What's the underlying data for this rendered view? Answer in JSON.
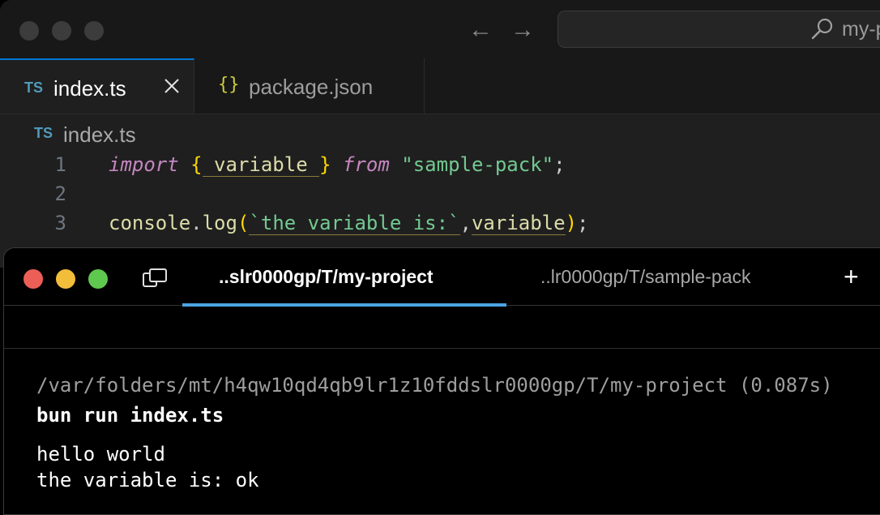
{
  "editor": {
    "search_text": "my-p",
    "tabs": [
      {
        "badge": "TS",
        "label": "index.ts"
      },
      {
        "badge": "{}",
        "label": "package.json"
      }
    ],
    "breadcrumb": {
      "badge": "TS",
      "label": "index.ts"
    },
    "code": [
      {
        "num": "1",
        "tokens": [
          "import",
          " ",
          "{",
          " variable ",
          "}",
          " ",
          "from",
          " ",
          "\"sample-pack\"",
          ";"
        ]
      },
      {
        "num": "2"
      },
      {
        "num": "3",
        "tokens": [
          "console",
          ".",
          "log",
          "(",
          "`the variable is:`",
          ",",
          "variable",
          ")",
          ";"
        ]
      }
    ]
  },
  "terminal": {
    "tabs": [
      "..slr0000gp/T/my-project",
      "..lr0000gp/T/sample-pack"
    ],
    "new_tab": "+",
    "output": {
      "path_line": "/var/folders/mt/h4qw10qd4qb9lr1z10fddslr0000gp/T/my-project (0.087s)",
      "command": "bun run index.ts",
      "lines": [
        "hello world",
        "the variable is: ok"
      ]
    }
  },
  "colors": {
    "tab_active_accent": "#0078d4",
    "terminal_tab_accent": "#4ba3e3",
    "traffic_red": "#ec5f57",
    "traffic_yellow": "#f2bd3a",
    "traffic_green": "#5fc84e"
  }
}
